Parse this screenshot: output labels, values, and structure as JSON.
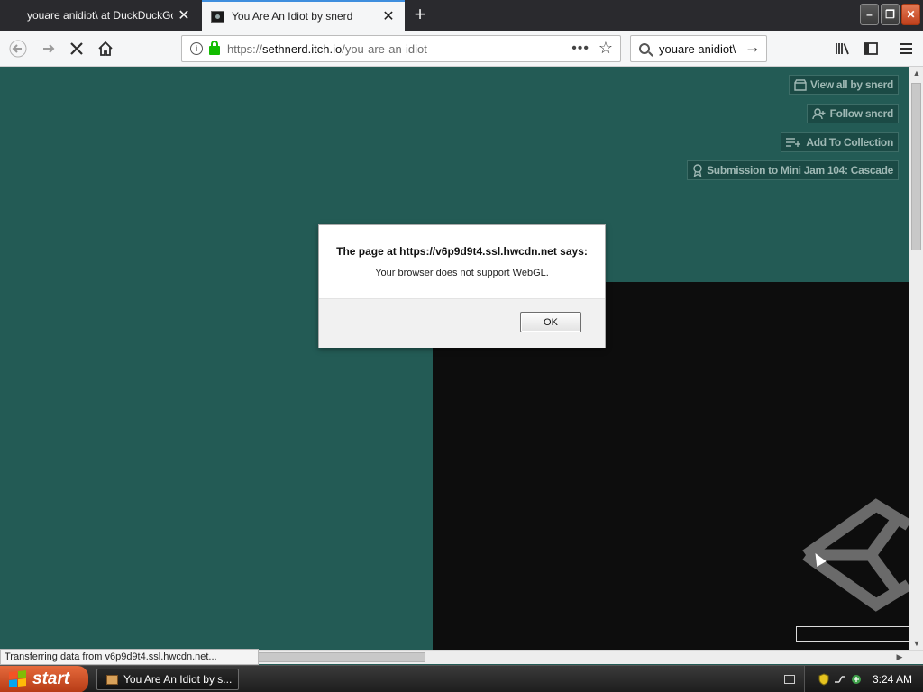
{
  "browser": {
    "tabs": [
      {
        "title": "youare anidiot\\ at DuckDuckGo",
        "active": false
      },
      {
        "title": "You Are An Idiot by snerd",
        "active": true
      }
    ],
    "url": {
      "scheme": "https://",
      "host": "sethnerd.itch.io",
      "path": "/you-are-an-idiot"
    },
    "search_text": "youare anidiot\\",
    "status_text": "Transferring data from v6p9d9t4.ssl.hwcdn.net..."
  },
  "page": {
    "buttons": [
      {
        "label": "View all by snerd",
        "icon": "store-icon"
      },
      {
        "label": "Follow snerd",
        "icon": "follow-user-icon"
      },
      {
        "label": "Add To Collection",
        "icon": "add-collection-icon"
      },
      {
        "label": "Submission to Mini Jam 104: Cascade",
        "icon": "award-icon"
      }
    ],
    "colors": {
      "background": "#235b55",
      "game_bg": "#0d0d0d"
    }
  },
  "dialog": {
    "title": "The page at https://v6p9d9t4.ssl.hwcdn.net says:",
    "message": "Your browser does not support WebGL.",
    "ok_label": "OK"
  },
  "taskbar": {
    "start_label": "start",
    "window_label": "You Are An Idiot by s...",
    "clock": "3:24 AM"
  }
}
